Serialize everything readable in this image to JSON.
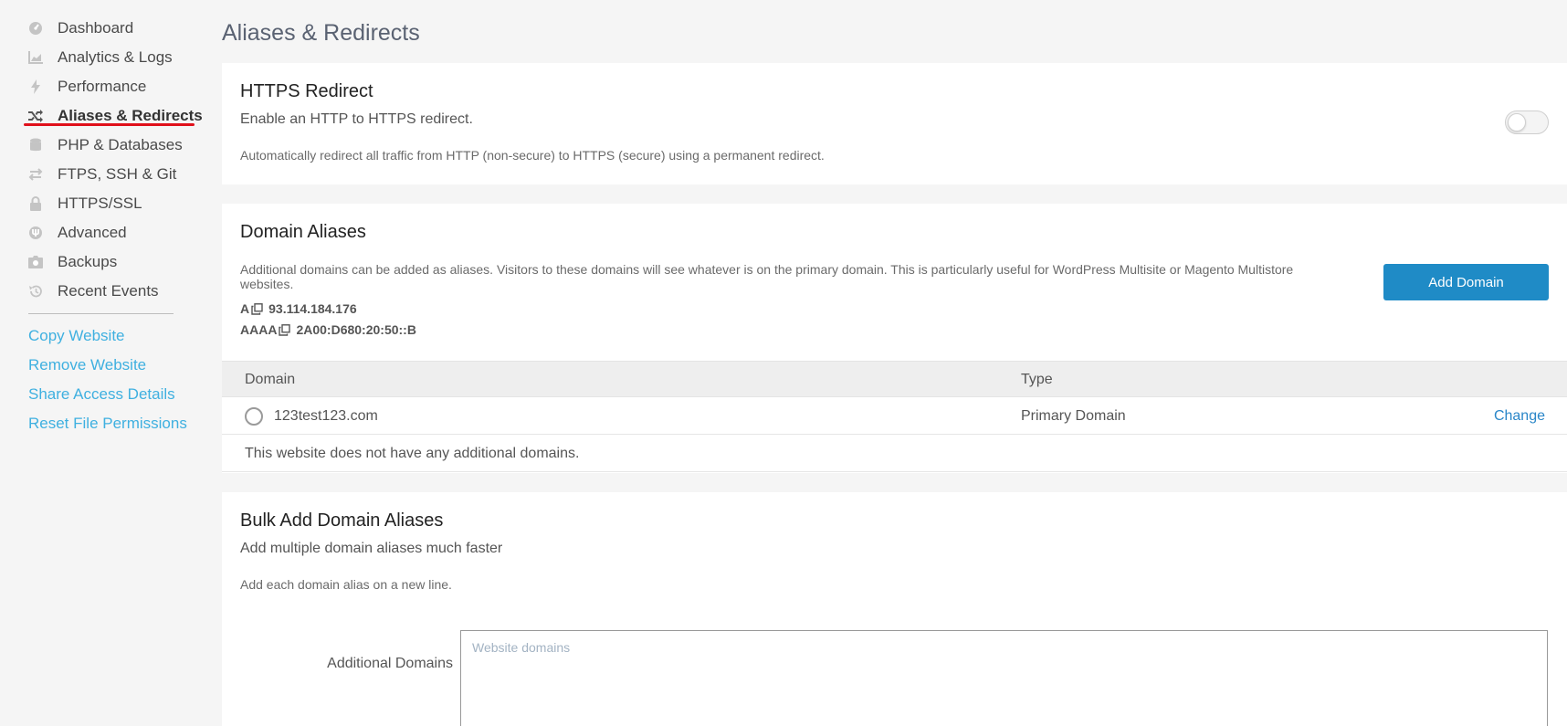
{
  "sidebar": {
    "items": [
      {
        "label": "Dashboard",
        "icon": "dashboard-icon"
      },
      {
        "label": "Analytics & Logs",
        "icon": "chart-icon"
      },
      {
        "label": "Performance",
        "icon": "lightning-icon"
      },
      {
        "label": "Aliases & Redirects",
        "icon": "shuffle-icon",
        "active": true
      },
      {
        "label": "PHP & Databases",
        "icon": "database-icon"
      },
      {
        "label": "FTPS, SSH & Git",
        "icon": "transfer-icon"
      },
      {
        "label": "HTTPS/SSL",
        "icon": "lock-icon"
      },
      {
        "label": "Advanced",
        "icon": "advanced-icon"
      },
      {
        "label": "Backups",
        "icon": "camera-icon"
      },
      {
        "label": "Recent Events",
        "icon": "history-icon"
      }
    ],
    "actions": [
      {
        "label": "Copy Website"
      },
      {
        "label": "Remove Website"
      },
      {
        "label": "Share Access Details"
      },
      {
        "label": "Reset File Permissions"
      }
    ]
  },
  "page": {
    "title": "Aliases & Redirects"
  },
  "https_redirect": {
    "title": "HTTPS Redirect",
    "subtitle": "Enable an HTTP to HTTPS redirect.",
    "note": "Automatically redirect all traffic from HTTP (non-secure) to HTTPS (secure) using a permanent redirect.",
    "enabled": false
  },
  "domain_aliases": {
    "title": "Domain Aliases",
    "description": "Additional domains can be added as aliases. Visitors to these domains will see whatever is on the primary domain. This is particularly useful for WordPress Multisite or Magento Multistore websites.",
    "add_button": "Add Domain",
    "a_label": "A",
    "a_value": "93.114.184.176",
    "aaaa_label": "AAAA",
    "aaaa_value": "2A00:D680:20:50::B",
    "columns": {
      "domain": "Domain",
      "type": "Type"
    },
    "rows": [
      {
        "domain": "123test123.com",
        "type": "Primary Domain",
        "action": "Change"
      }
    ],
    "empty_message": "This website does not have any additional domains."
  },
  "bulk_add": {
    "title": "Bulk Add Domain Aliases",
    "subtitle": "Add multiple domain aliases much faster",
    "note": "Add each domain alias on a new line.",
    "field_label": "Additional Domains",
    "placeholder": "Website domains",
    "value": ""
  },
  "colors": {
    "accent": "#1f8bc6",
    "link": "#3fb0e0",
    "active_underline": "#e0101b"
  }
}
